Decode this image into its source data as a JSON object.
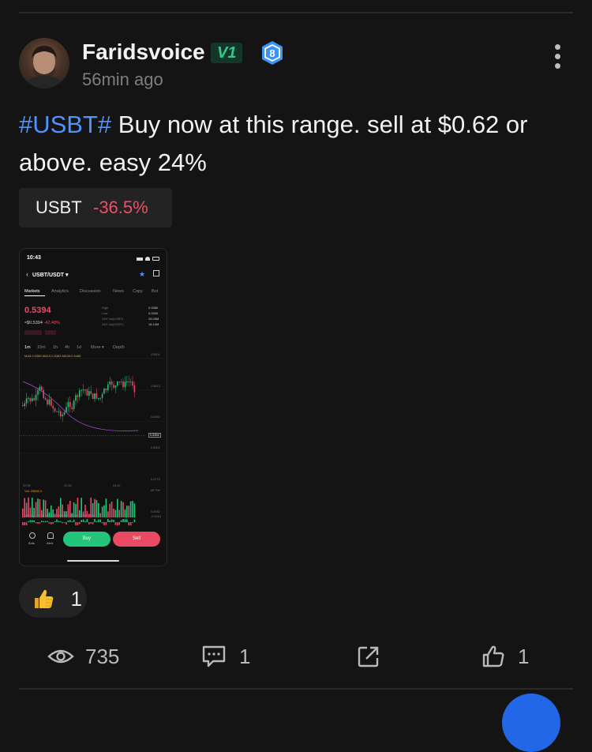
{
  "post": {
    "author": {
      "name": "Faridsvoice",
      "vip_badge": "V1",
      "level": "8"
    },
    "time_ago": "56min ago",
    "hashtag": "#USBT#",
    "body": " Buy now at this range. sell at $0.62 or above. easy 24%",
    "coin_tag": {
      "symbol": "USBT",
      "change": "-36.5%"
    },
    "reaction": {
      "emoji": "thumbs-up-emoji",
      "count": "1"
    },
    "stats": {
      "views": "735",
      "comments": "1",
      "likes": "1"
    }
  },
  "screenshot": {
    "status_time": "10:43",
    "pair": "USBT/USDT",
    "tabs": [
      "Markets",
      "Analytics",
      "Discussion",
      "News",
      "Copy",
      "Bot"
    ],
    "price": "0.5394",
    "price_sub": "≈$0.5394",
    "price_change": "-42.48%",
    "stats_labels": [
      "High",
      "Low",
      "24H Vol(USBT)",
      "24H Vol(USDT)"
    ],
    "stats_values": [
      "0.9380",
      "0.5300",
      "26.09M",
      "18.10M"
    ],
    "intervals": [
      "1m",
      "15m",
      "1h",
      "4h",
      "1d",
      "More ▾",
      "Depth"
    ],
    "ma_line": "MA5:0.5385  MA10:0.5383  MA30:0.5488",
    "axis_values": [
      "0.5504",
      "0.5813",
      "0.5453",
      "0.5394",
      "0.5303",
      "0.4773",
      "0.4683"
    ],
    "time_labels": [
      "22:08",
      "22:26",
      "22:42"
    ],
    "vol_label": "Vol: 25662.2",
    "vol_axis": "65.70K",
    "macd_label": "MACD(12,26,9)  MACD:0.0005  DIF:-0.0005  DEA:0.0004",
    "macd_axis": [
      "0.0032",
      "-0.0014"
    ],
    "bottom_items": [
      "Bots",
      "Alert"
    ],
    "buy_label": "Buy",
    "sell_label": "Sell",
    "colors": {
      "up": "#22c57a",
      "down": "#e84a63"
    }
  },
  "colors": {
    "accent_blue": "#4e93ff",
    "negative": "#ef4f66",
    "vip_green": "#32c98a",
    "level_blue": "#3d93f5"
  }
}
